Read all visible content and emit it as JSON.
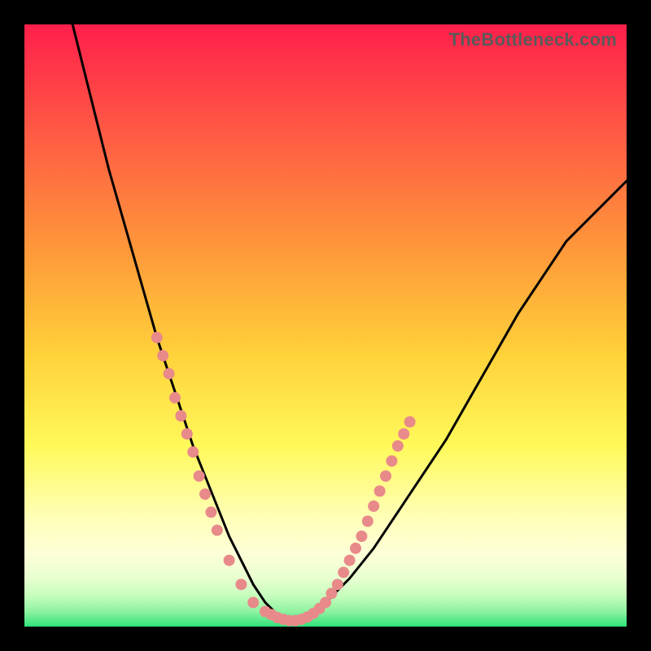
{
  "attribution": "TheBottleneck.com",
  "colors": {
    "black": "#000000",
    "curve": "#000000",
    "marker": "#e88a8a",
    "grad_top": "#ff1f4b",
    "grad_mid1": "#ff6a3c",
    "grad_mid2": "#ffd23a",
    "grad_mid3": "#fff95a",
    "grad_low1": "#fdffd0",
    "grad_low2": "#d7ffc2",
    "grad_low3": "#9cf5a6",
    "grad_bottom": "#2fe27a"
  },
  "chart_data": {
    "type": "line",
    "title": "",
    "xlabel": "",
    "ylabel": "",
    "xlim": [
      0,
      100
    ],
    "ylim": [
      0,
      100
    ],
    "series": [
      {
        "name": "bottleneck-curve",
        "x": [
          8,
          10,
          12,
          14,
          16,
          18,
          20,
          22,
          24,
          26,
          28,
          30,
          32,
          34,
          36,
          38,
          40,
          42,
          44,
          46,
          48,
          50,
          54,
          58,
          62,
          66,
          70,
          74,
          78,
          82,
          86,
          90,
          94,
          98,
          100
        ],
        "y": [
          100,
          92,
          84,
          76,
          69,
          62,
          55,
          48,
          42,
          36,
          30,
          25,
          20,
          15,
          11,
          7,
          4,
          2,
          1,
          1,
          2,
          4,
          8,
          13,
          19,
          25,
          31,
          38,
          45,
          52,
          58,
          64,
          68,
          72,
          74
        ]
      }
    ],
    "markers": [
      {
        "x": 22,
        "y": 48
      },
      {
        "x": 23,
        "y": 45
      },
      {
        "x": 24,
        "y": 42
      },
      {
        "x": 25,
        "y": 38
      },
      {
        "x": 26,
        "y": 35
      },
      {
        "x": 27,
        "y": 32
      },
      {
        "x": 28,
        "y": 29
      },
      {
        "x": 29,
        "y": 25
      },
      {
        "x": 30,
        "y": 22
      },
      {
        "x": 31,
        "y": 19
      },
      {
        "x": 32,
        "y": 16
      },
      {
        "x": 34,
        "y": 11
      },
      {
        "x": 36,
        "y": 7
      },
      {
        "x": 38,
        "y": 4
      },
      {
        "x": 40,
        "y": 2.5
      },
      {
        "x": 41,
        "y": 2
      },
      {
        "x": 42,
        "y": 1.5
      },
      {
        "x": 43,
        "y": 1.2
      },
      {
        "x": 44,
        "y": 1
      },
      {
        "x": 45,
        "y": 1
      },
      {
        "x": 46,
        "y": 1.2
      },
      {
        "x": 47,
        "y": 1.6
      },
      {
        "x": 48,
        "y": 2.2
      },
      {
        "x": 49,
        "y": 3
      },
      {
        "x": 50,
        "y": 4
      },
      {
        "x": 51,
        "y": 5.5
      },
      {
        "x": 52,
        "y": 7
      },
      {
        "x": 53,
        "y": 9
      },
      {
        "x": 54,
        "y": 11
      },
      {
        "x": 55,
        "y": 13
      },
      {
        "x": 56,
        "y": 15
      },
      {
        "x": 57,
        "y": 17.5
      },
      {
        "x": 58,
        "y": 20
      },
      {
        "x": 59,
        "y": 22.5
      },
      {
        "x": 60,
        "y": 25
      },
      {
        "x": 61,
        "y": 27.5
      },
      {
        "x": 62,
        "y": 30
      },
      {
        "x": 63,
        "y": 32
      },
      {
        "x": 64,
        "y": 34
      }
    ]
  }
}
